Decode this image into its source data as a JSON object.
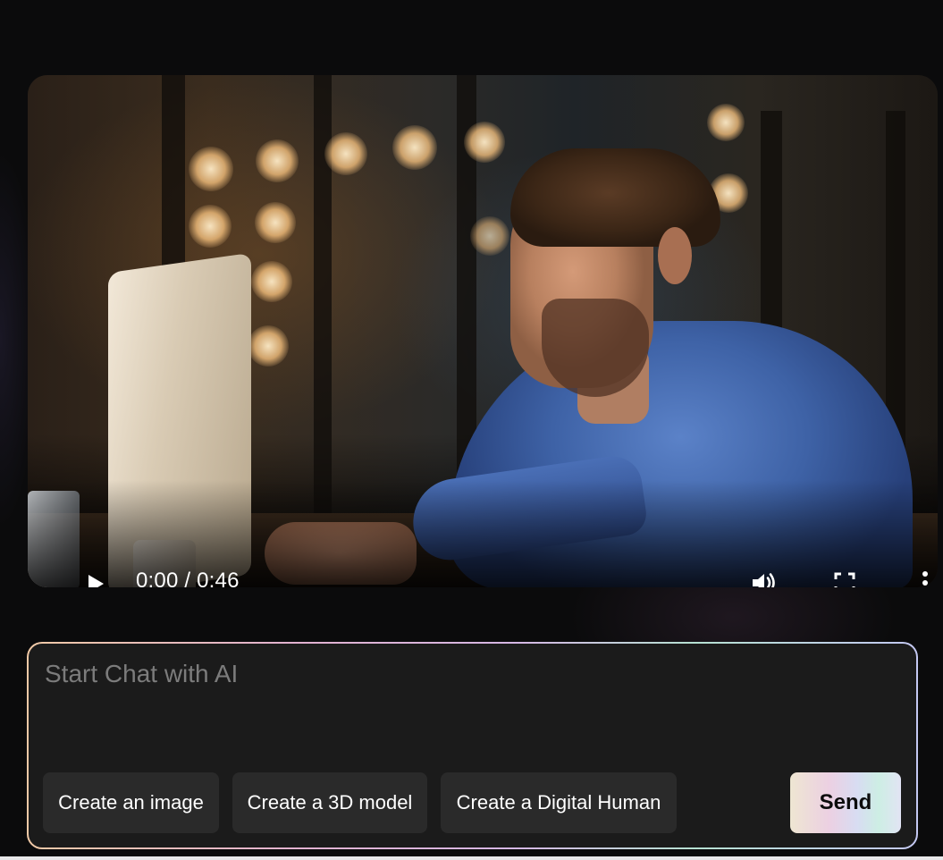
{
  "video": {
    "time_display": "0:00 / 0:46",
    "progress_fraction": 0.02,
    "icons": {
      "play": "play-icon",
      "volume": "volume-icon",
      "fullscreen": "fullscreen-icon",
      "more": "more-vertical-icon"
    }
  },
  "chat": {
    "placeholder": "Start Chat with AI",
    "value": "",
    "suggestions": [
      {
        "label": "Create an image"
      },
      {
        "label": "Create a 3D model"
      },
      {
        "label": "Create a Digital Human"
      }
    ],
    "send_label": "Send"
  },
  "colors": {
    "background": "#0b0b0c",
    "chat_background": "#1b1b1b",
    "chip_background": "#2a2a2a",
    "text": "#ffffff"
  }
}
